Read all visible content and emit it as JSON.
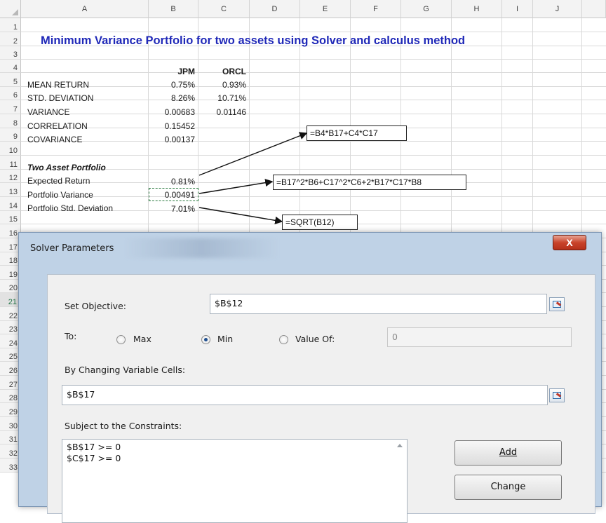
{
  "spreadsheet": {
    "columns": [
      "A",
      "B",
      "C",
      "D",
      "E",
      "F",
      "G",
      "H",
      "I",
      "J"
    ],
    "rows": [
      "1",
      "2",
      "3",
      "4",
      "5",
      "6",
      "7",
      "8",
      "9",
      "10",
      "11",
      "12",
      "13",
      "14",
      "15",
      "16",
      "17",
      "18",
      "19",
      "20",
      "21",
      "22",
      "23",
      "24",
      "25",
      "26",
      "27",
      "28",
      "29",
      "30",
      "31",
      "32",
      "33"
    ],
    "selected_row": "21",
    "title": "Minimum Variance Portfolio for two assets using Solver and calculus method",
    "headers": {
      "jpm": "JPM",
      "orcl": "ORCL"
    },
    "stats": [
      {
        "label": "MEAN RETURN",
        "jpm": "0.75%",
        "orcl": "0.93%"
      },
      {
        "label": "STD. DEVIATION",
        "jpm": "8.26%",
        "orcl": "10.71%"
      },
      {
        "label": "VARIANCE",
        "jpm": "0.00683",
        "orcl": "0.01146"
      },
      {
        "label": "CORRELATION",
        "jpm": "0.15452",
        "orcl": ""
      },
      {
        "label": "COVARIANCE",
        "jpm": "0.00137",
        "orcl": ""
      }
    ],
    "portfolio_heading": "Two Asset Portfolio",
    "portfolio": [
      {
        "label": "Expected Return",
        "value": "0.81%"
      },
      {
        "label": "Portfolio Variance",
        "value": "0.00491"
      },
      {
        "label": "Portfolio Std. Deviation",
        "value": "7.01%"
      }
    ],
    "callouts": [
      "=B4*B17+C4*C17",
      "=B17^2*B6+C17^2*C6+2*B17*C17*B8",
      "=SQRT(B12)"
    ]
  },
  "dialog": {
    "title": "Solver Parameters",
    "close_label": "X",
    "set_objective_label": "Set Objective:",
    "set_objective_value": "$B$12",
    "to_label": "To:",
    "radio_max": "Max",
    "radio_min": "Min",
    "radio_value_of": "Value Of:",
    "value_of_input": "0",
    "selected_radio": "min",
    "changing_cells_label": "By Changing Variable Cells:",
    "changing_cells_value": "$B$17",
    "constraints_label": "Subject to the Constraints:",
    "constraints": [
      "$B$17 >= 0",
      "$C$17 >= 0"
    ],
    "add_button": "Add",
    "change_button": "Change"
  }
}
